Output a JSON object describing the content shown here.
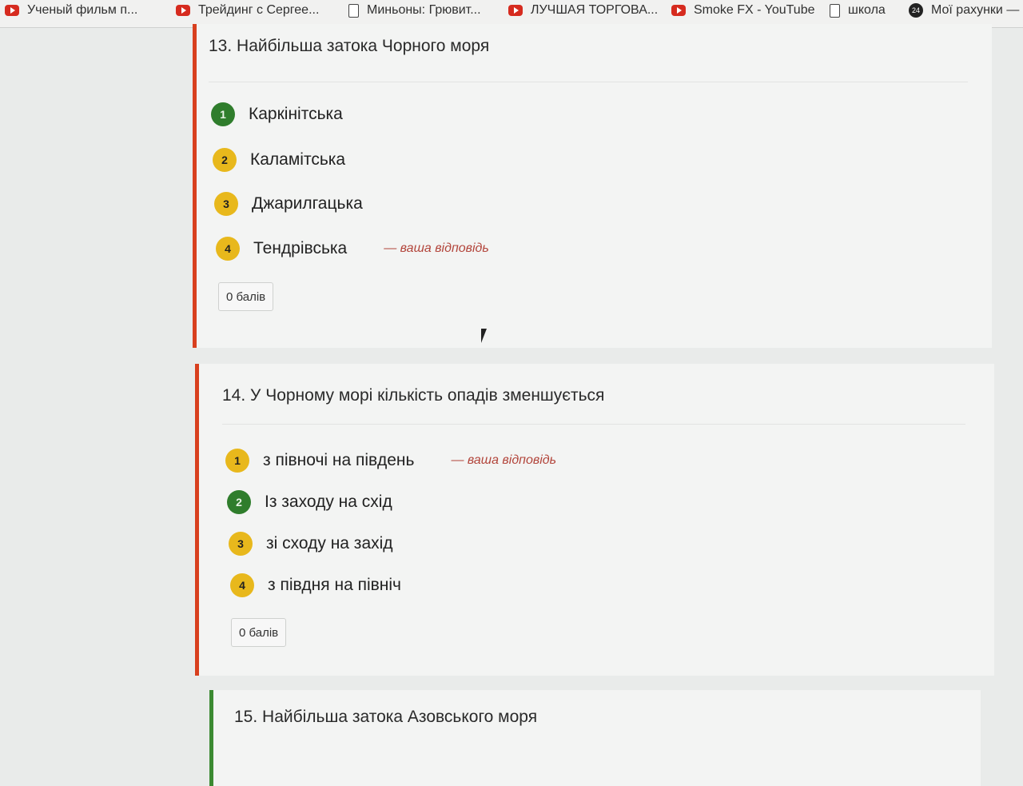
{
  "bookmarks": [
    {
      "label": "Ученый фильм п...",
      "icon": "youtube-icon"
    },
    {
      "label": "Трейдинг с Сергее...",
      "icon": "youtube-icon"
    },
    {
      "label": "Миньоны: Грювит...",
      "icon": "document-icon"
    },
    {
      "label": "ЛУЧШАЯ ТОРГОВА...",
      "icon": "youtube-icon"
    },
    {
      "label": "Smoke FX - YouTube",
      "icon": "youtube-icon"
    },
    {
      "label": "школа",
      "icon": "document-icon"
    },
    {
      "label": "Мої рахунки —",
      "icon": "account-icon",
      "icon_text": "24"
    }
  ],
  "questions": [
    {
      "title": "13. Найбільша затока Чорного моря",
      "options": [
        {
          "num": "1",
          "text": "Каркінітська",
          "status": "correct"
        },
        {
          "num": "2",
          "text": "Каламітська",
          "status": "other"
        },
        {
          "num": "3",
          "text": "Джарилгацька",
          "status": "other"
        },
        {
          "num": "4",
          "text": "Тендрівська",
          "status": "other",
          "your_answer": "— ваша відповідь"
        }
      ],
      "score": "0 балів",
      "border_color": "#d8401f"
    },
    {
      "title": "14. У Чорному морі кількість опадів зменшується",
      "options": [
        {
          "num": "1",
          "text": "з півночі на південь",
          "status": "other",
          "your_answer": "— ваша відповідь"
        },
        {
          "num": "2",
          "text": "Із заходу на схід",
          "status": "correct"
        },
        {
          "num": "3",
          "text": "зі сходу на захід",
          "status": "other"
        },
        {
          "num": "4",
          "text": "з півдня на північ",
          "status": "other"
        }
      ],
      "score": "0 балів",
      "border_color": "#d8401f"
    },
    {
      "title": "15. Найбільша затока Азовського моря",
      "border_color": "#3c8a32"
    }
  ],
  "colors": {
    "correct_badge": "#2f7d2c",
    "option_badge": "#e8b81c",
    "your_answer_text": "#b2443a"
  }
}
